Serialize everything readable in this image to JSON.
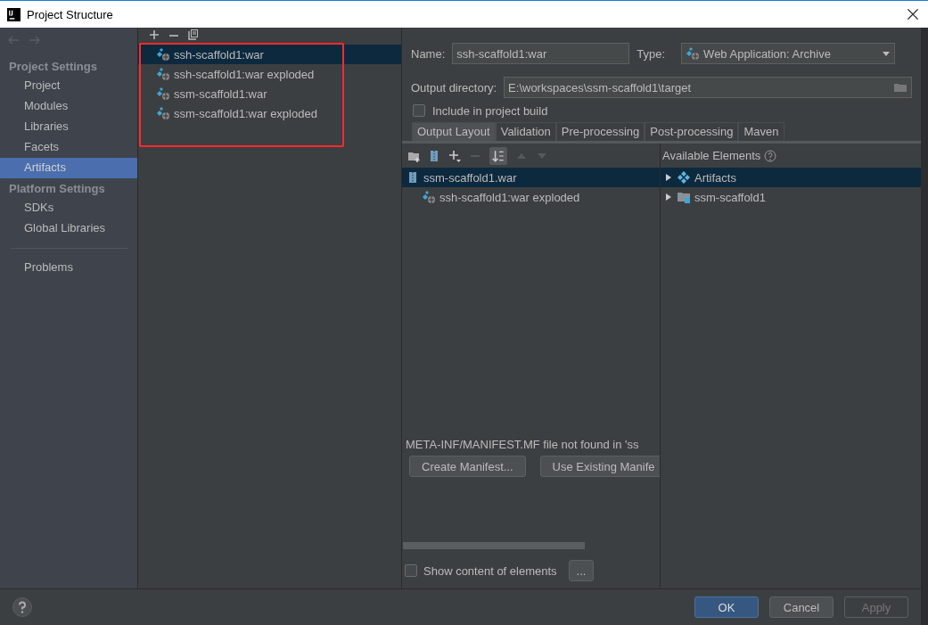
{
  "window": {
    "title": "Project Structure"
  },
  "sidebar": {
    "sections": [
      {
        "heading": "Project Settings",
        "items": [
          {
            "label": "Project",
            "selected": false
          },
          {
            "label": "Modules",
            "selected": false
          },
          {
            "label": "Libraries",
            "selected": false
          },
          {
            "label": "Facets",
            "selected": false
          },
          {
            "label": "Artifacts",
            "selected": true
          }
        ]
      },
      {
        "heading": "Platform Settings",
        "items": [
          {
            "label": "SDKs",
            "selected": false
          },
          {
            "label": "Global Libraries",
            "selected": false
          }
        ]
      }
    ],
    "footer_items": [
      {
        "label": "Problems",
        "selected": false
      }
    ]
  },
  "artifacts": [
    {
      "label": "ssh-scaffold1:war",
      "selected": true
    },
    {
      "label": "ssh-scaffold1:war exploded",
      "selected": false
    },
    {
      "label": "ssm-scaffold1:war",
      "selected": false
    },
    {
      "label": "ssm-scaffold1:war exploded",
      "selected": false
    }
  ],
  "form": {
    "name_label": "Name:",
    "name_value": "ssh-scaffold1:war",
    "type_label": "Type:",
    "type_value": "Web Application: Archive",
    "output_label": "Output directory:",
    "output_value": "E:\\workspaces\\ssm-scaffold1\\target",
    "include": {
      "label": "Include in project build",
      "checked": false
    }
  },
  "tabs": [
    {
      "label": "Output Layout",
      "selected": true
    },
    {
      "label": "Validation",
      "selected": false
    },
    {
      "label": "Pre-processing",
      "selected": false
    },
    {
      "label": "Post-processing",
      "selected": false
    },
    {
      "label": "Maven",
      "selected": false
    }
  ],
  "layout_tree": [
    {
      "label": "ssm-scaffold1.war",
      "kind": "archive",
      "selected": true,
      "children": [
        {
          "label": "ssh-scaffold1:war exploded",
          "kind": "artifact",
          "selected": false
        }
      ]
    }
  ],
  "available": {
    "title": "Available Elements",
    "items": [
      {
        "label": "Artifacts",
        "kind": "artifacts",
        "expanded": false,
        "selected": true
      },
      {
        "label": "ssm-scaffold1",
        "kind": "module",
        "expanded": false,
        "selected": false
      }
    ]
  },
  "manifest": {
    "message": "META-INF/MANIFEST.MF file not found in 'ss",
    "buttons": [
      "Create Manifest...",
      "Use Existing Manife"
    ]
  },
  "show_content": {
    "label": "Show content of elements",
    "checked": false,
    "button": "..."
  },
  "dialog_buttons": [
    {
      "label": "OK",
      "kind": "primary",
      "disabled": false
    },
    {
      "label": "Cancel",
      "kind": "normal",
      "disabled": false
    },
    {
      "label": "Apply",
      "kind": "normal",
      "disabled": true
    }
  ]
}
